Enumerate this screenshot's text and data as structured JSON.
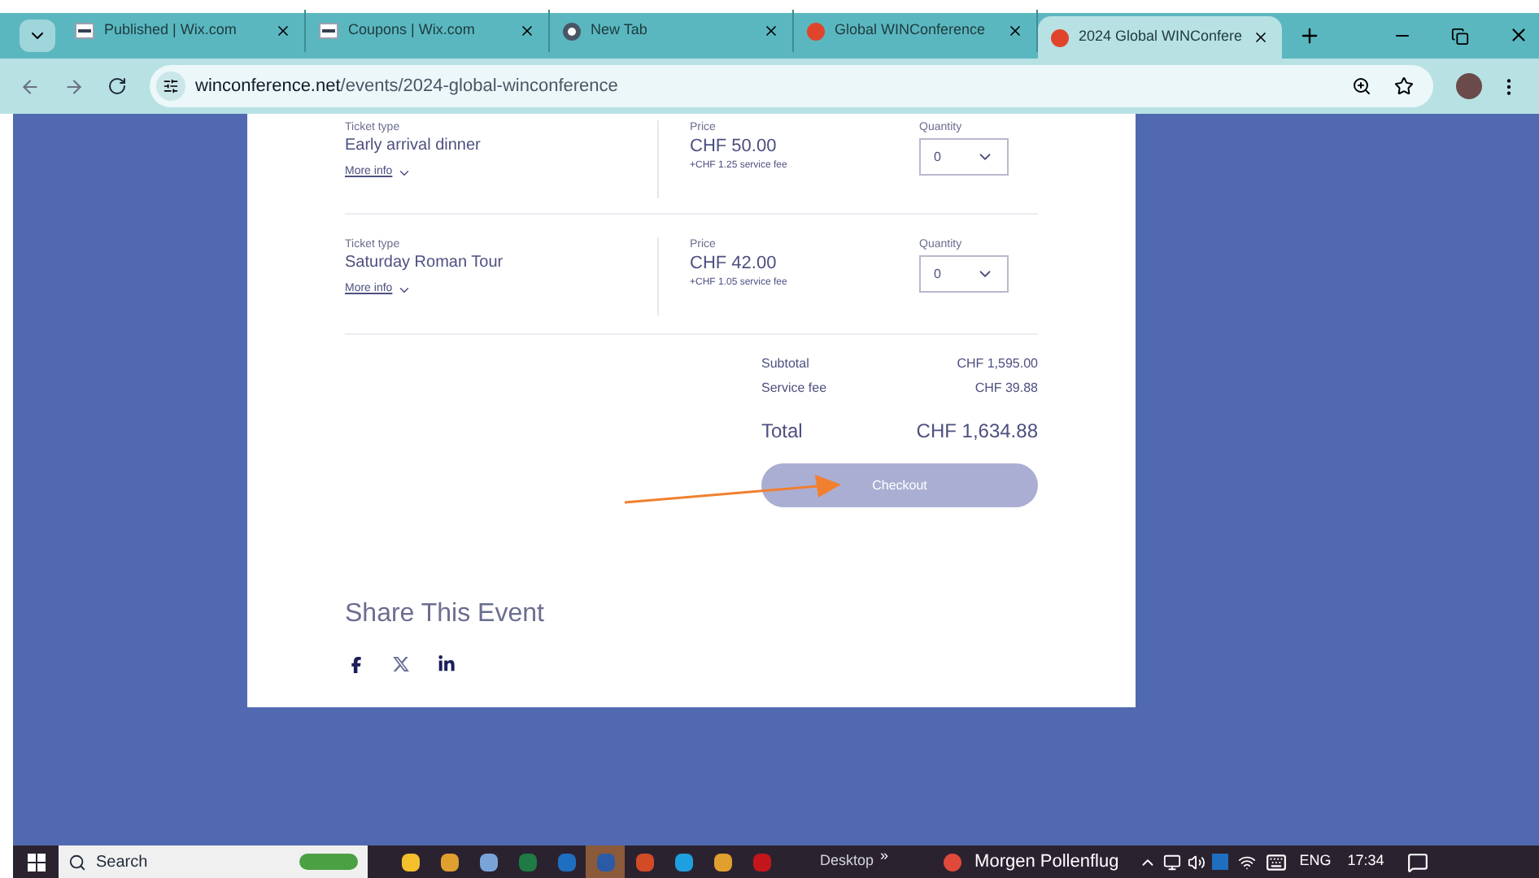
{
  "browser": {
    "tabs": [
      {
        "title": "Published | Wix.com",
        "kind": "wix",
        "selected": false
      },
      {
        "title": "Coupons | Wix.com",
        "kind": "wix",
        "selected": false
      },
      {
        "title": "New Tab",
        "kind": "chrome",
        "selected": false
      },
      {
        "title": "Global WINConference",
        "kind": "win",
        "selected": false
      },
      {
        "title": "2024 Global WINConfere",
        "kind": "win",
        "selected": true
      }
    ],
    "url_host": "winconference.net",
    "url_path": "/events/2024-global-winconference"
  },
  "tickets": [
    {
      "type_label": "Ticket type",
      "name": "Early arrival dinner",
      "more_info": "More info",
      "price_label": "Price",
      "price": "CHF 50.00",
      "fee": "+CHF 1.25 service fee",
      "quantity_label": "Quantity",
      "quantity": "0"
    },
    {
      "type_label": "Ticket type",
      "name": "Saturday Roman Tour",
      "more_info": "More info",
      "price_label": "Price",
      "price": "CHF 42.00",
      "fee": "+CHF 1.05 service fee",
      "quantity_label": "Quantity",
      "quantity": "0"
    }
  ],
  "summary": {
    "subtotal_label": "Subtotal",
    "subtotal": "CHF 1,595.00",
    "fee_label": "Service fee",
    "fee": "CHF 39.88",
    "total_label": "Total",
    "total": "CHF 1,634.88"
  },
  "checkout": {
    "label": "Checkout",
    "disabled": true
  },
  "share": {
    "title": "Share This Event",
    "networks": [
      {
        "kind": "facebook"
      },
      {
        "kind": "x"
      },
      {
        "kind": "linkedin"
      }
    ]
  },
  "taskbar": {
    "search": "Search",
    "apps": [
      {
        "kind": "folder"
      },
      {
        "kind": "chrome"
      },
      {
        "kind": "paint"
      },
      {
        "kind": "excel"
      },
      {
        "kind": "outlook"
      },
      {
        "kind": "word",
        "selected": true
      },
      {
        "kind": "powerpoint"
      },
      {
        "kind": "skype"
      },
      {
        "kind": "chrome"
      },
      {
        "kind": "acrobat"
      }
    ],
    "toolbar": "Desktop",
    "toolbar_more": "»",
    "weather": "Morgen Pollenflug",
    "language": "ENG",
    "time": "17:34"
  }
}
